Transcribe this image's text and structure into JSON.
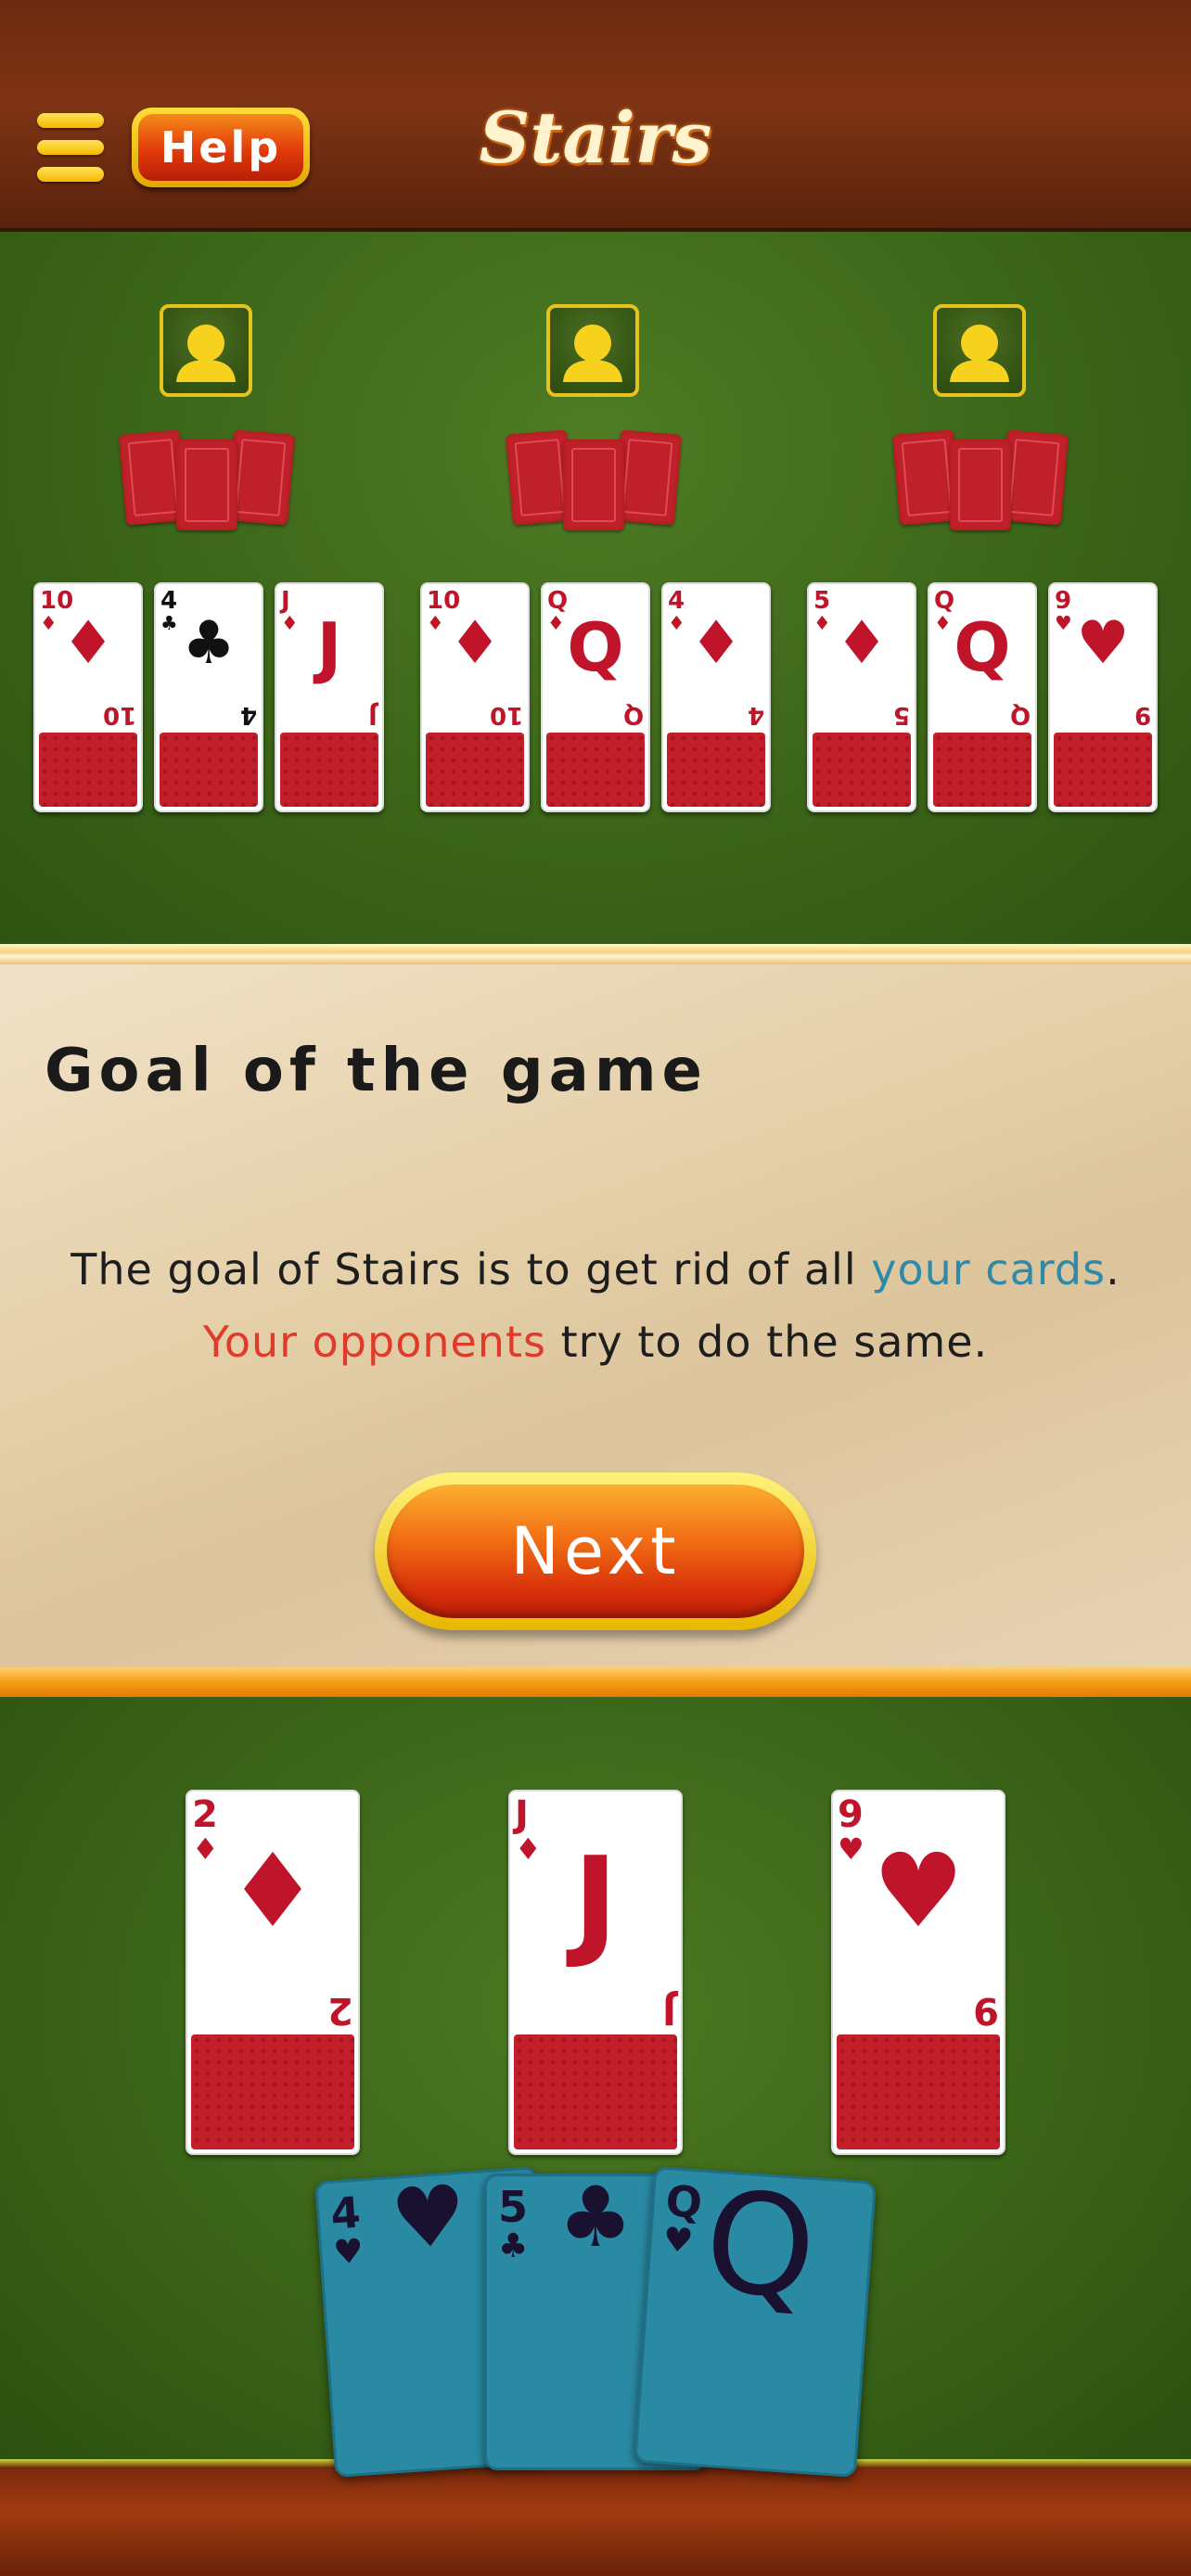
{
  "header": {
    "title": "Stairs",
    "help_label": "Help",
    "menu_icon": "hamburger-menu-icon"
  },
  "opponents": [
    {
      "avatar_icon": "user-silhouette-icon",
      "hidden_cards": 3,
      "table_cards": [
        {
          "rank": "10",
          "suit": "♦"
        },
        {
          "rank": "4",
          "suit": "♣"
        },
        {
          "rank": "J",
          "suit": "♦"
        }
      ]
    },
    {
      "avatar_icon": "user-silhouette-icon",
      "hidden_cards": 3,
      "table_cards": [
        {
          "rank": "10",
          "suit": "♦"
        },
        {
          "rank": "Q",
          "suit": "♦"
        },
        {
          "rank": "4",
          "suit": "♦"
        }
      ]
    },
    {
      "avatar_icon": "user-silhouette-icon",
      "hidden_cards": 3,
      "table_cards": [
        {
          "rank": "5",
          "suit": "♦"
        },
        {
          "rank": "Q",
          "suit": "♦"
        },
        {
          "rank": "9",
          "suit": "♥"
        }
      ]
    }
  ],
  "tutorial": {
    "heading": "Goal of the game",
    "line1_prefix": "The goal of Stairs is to get rid of all ",
    "line1_highlight": "your cards",
    "line1_suffix": ".",
    "line2_highlight": "Your opponents",
    "line2_suffix": " try to do the same.",
    "next_label": "Next"
  },
  "player": {
    "table_cards": [
      {
        "rank": "2",
        "suit": "♦"
      },
      {
        "rank": "J",
        "suit": "♦"
      },
      {
        "rank": "9",
        "suit": "♥"
      }
    ],
    "hand_cards": [
      {
        "rank": "4",
        "suit": "♥"
      },
      {
        "rank": "5",
        "suit": "♣"
      },
      {
        "rank": "Q",
        "suit": "♥"
      }
    ]
  },
  "colors": {
    "felt": "#3b6518",
    "wood": "#7e3414",
    "card_back": "#c0202a",
    "hand_card": "#2a8aa4",
    "highlight_blue": "#2e8aa6",
    "highlight_red": "#e03a2a",
    "button_orange": "#f27014"
  }
}
